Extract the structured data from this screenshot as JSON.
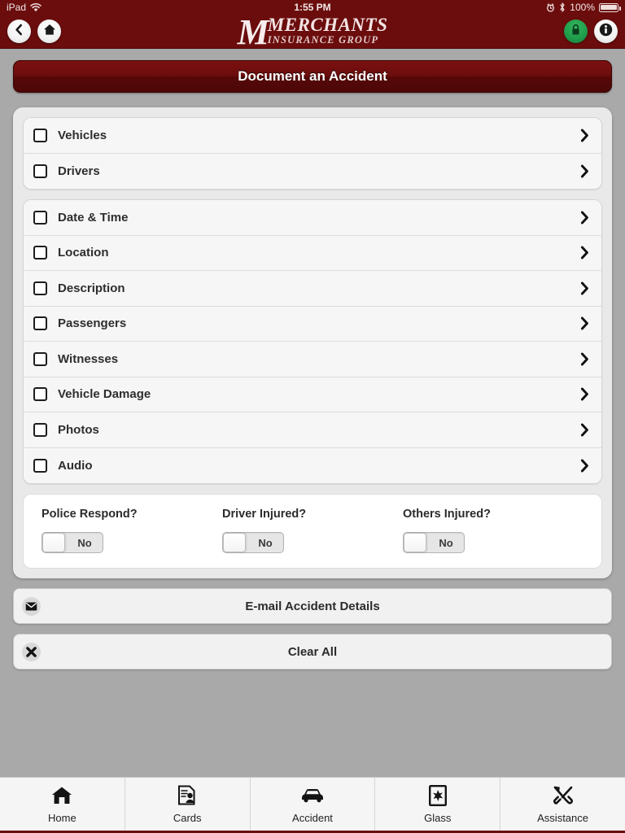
{
  "statusbar": {
    "device": "iPad",
    "wifi_icon": "wifi-icon",
    "time": "1:55 PM",
    "alarm_icon": "alarm-clock-icon",
    "bluetooth_icon": "bluetooth-icon",
    "battery_percent": "100%",
    "battery_icon": "battery-full-icon"
  },
  "navbar": {
    "back_icon": "chevron-left-icon",
    "home_icon": "home-icon",
    "lock_icon": "lock-icon",
    "info_icon": "info-icon",
    "logo_mark": "M",
    "logo_name": "MERCHANTS",
    "logo_sub": "INSURANCE GROUP",
    "accent_color": "#6b0d0d",
    "lock_color": "#1f9c4a"
  },
  "page": {
    "title": "Document an Accident"
  },
  "groups": [
    {
      "rows": [
        {
          "label": "Vehicles",
          "checked": false,
          "chevron": "chevron-right-icon"
        },
        {
          "label": "Drivers",
          "checked": false,
          "chevron": "chevron-right-icon"
        }
      ]
    },
    {
      "rows": [
        {
          "label": "Date & Time",
          "checked": false,
          "chevron": "chevron-right-icon"
        },
        {
          "label": "Location",
          "checked": false,
          "chevron": "chevron-right-icon"
        },
        {
          "label": "Description",
          "checked": false,
          "chevron": "chevron-right-icon"
        },
        {
          "label": "Passengers",
          "checked": false,
          "chevron": "chevron-right-icon"
        },
        {
          "label": "Witnesses",
          "checked": false,
          "chevron": "chevron-right-icon"
        },
        {
          "label": "Vehicle Damage",
          "checked": false,
          "chevron": "chevron-right-icon"
        },
        {
          "label": "Photos",
          "checked": false,
          "chevron": "chevron-right-icon"
        },
        {
          "label": "Audio",
          "checked": false,
          "chevron": "chevron-right-icon"
        }
      ]
    }
  ],
  "toggles": [
    {
      "label": "Police Respond?",
      "value": "No"
    },
    {
      "label": "Driver Injured?",
      "value": "No"
    },
    {
      "label": "Others Injured?",
      "value": "No"
    }
  ],
  "actions": [
    {
      "label": "E-mail Accident Details",
      "icon": "envelope-icon"
    },
    {
      "label": "Clear All",
      "icon": "x-mark-icon"
    }
  ],
  "tabbar": {
    "items": [
      {
        "label": "Home",
        "icon": "home-icon"
      },
      {
        "label": "Cards",
        "icon": "id-card-icon"
      },
      {
        "label": "Accident",
        "icon": "car-icon"
      },
      {
        "label": "Glass",
        "icon": "cracked-glass-icon"
      },
      {
        "label": "Assistance",
        "icon": "tools-icon"
      }
    ]
  }
}
